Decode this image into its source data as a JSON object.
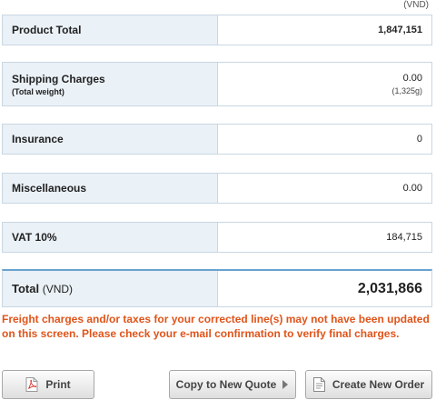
{
  "currency_note": "(VND)",
  "rows": [
    {
      "label": "Product Total",
      "value": "1,847,151"
    },
    {
      "label": "Shipping Charges",
      "sublabel": "(Total weight)",
      "value": "0.00",
      "subvalue": "(1,325g)"
    },
    {
      "label": "Insurance",
      "value": "0"
    },
    {
      "label": "Miscellaneous",
      "value": "0.00"
    },
    {
      "label": "VAT 10%",
      "value": "184,715"
    }
  ],
  "total": {
    "label": "Total",
    "unit": "(VND)",
    "value": "2,031,866"
  },
  "warning": "Freight charges and/or taxes for your corrected line(s) may not have been updated on this screen. Please check your e-mail confirmation to verify final charges.",
  "buttons": {
    "print": {
      "label": "Print",
      "icon": "pdf-icon"
    },
    "copy_quote": {
      "label": "Copy to New Quote",
      "icon": "arrow-right-icon"
    },
    "new_order": {
      "label": "Create New Order",
      "icon": "document-icon"
    }
  },
  "colors": {
    "warning": "#e0541a",
    "label_bg": "#eaf1f7",
    "total_rule": "#6aa2cf"
  }
}
